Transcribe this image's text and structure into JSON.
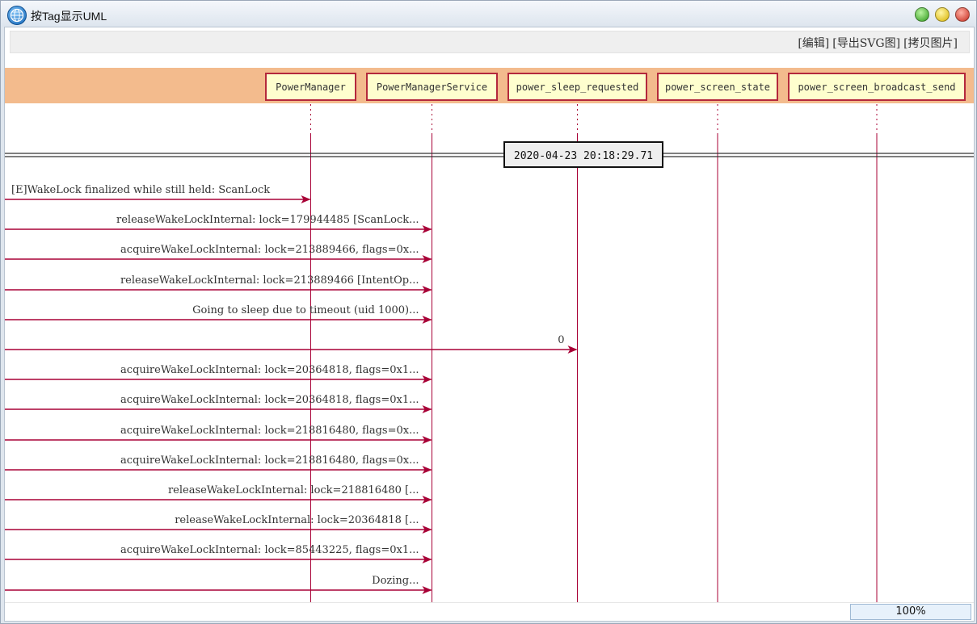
{
  "window": {
    "title": "按Tag显示UML"
  },
  "toolbar": {
    "edit": "[编辑]",
    "export_svg": "[导出SVG图]",
    "copy_image": "[拷贝图片]"
  },
  "participants": [
    "PowerManager",
    "PowerManagerService",
    "power_sleep_requested",
    "power_screen_state",
    "power_screen_broadcast_send"
  ],
  "divider": {
    "timestamp": "2020-04-23 20:18:29.71"
  },
  "messages": [
    {
      "label": "[E]WakeLock finalized while still held: ScanLock",
      "to": 0
    },
    {
      "label": "releaseWakeLockInternal: lock=179944485 [ScanLock...",
      "to": 1
    },
    {
      "label": "acquireWakeLockInternal: lock=213889466, flags=0x...",
      "to": 1
    },
    {
      "label": "releaseWakeLockInternal: lock=213889466 [IntentOp...",
      "to": 1
    },
    {
      "label": "Going to sleep due to timeout (uid 1000)...",
      "to": 1
    },
    {
      "label": "0",
      "to": 2
    },
    {
      "label": "acquireWakeLockInternal: lock=20364818, flags=0x1...",
      "to": 1
    },
    {
      "label": "acquireWakeLockInternal: lock=20364818, flags=0x1...",
      "to": 1
    },
    {
      "label": "acquireWakeLockInternal: lock=218816480, flags=0x...",
      "to": 1
    },
    {
      "label": "acquireWakeLockInternal: lock=218816480, flags=0x...",
      "to": 1
    },
    {
      "label": "releaseWakeLockInternal: lock=218816480 [...",
      "to": 1
    },
    {
      "label": "releaseWakeLockInternal: lock=20364818 [...",
      "to": 1
    },
    {
      "label": "acquireWakeLockInternal: lock=85443225, flags=0x1...",
      "to": 1
    },
    {
      "label": "Dozing...",
      "to": 1
    }
  ],
  "status": {
    "zoom": "100%"
  },
  "colors": {
    "arrow": "#a80036",
    "lifeline": "#a80036",
    "header_band": "#f3bb8d",
    "participant_fill": "#fefece"
  }
}
